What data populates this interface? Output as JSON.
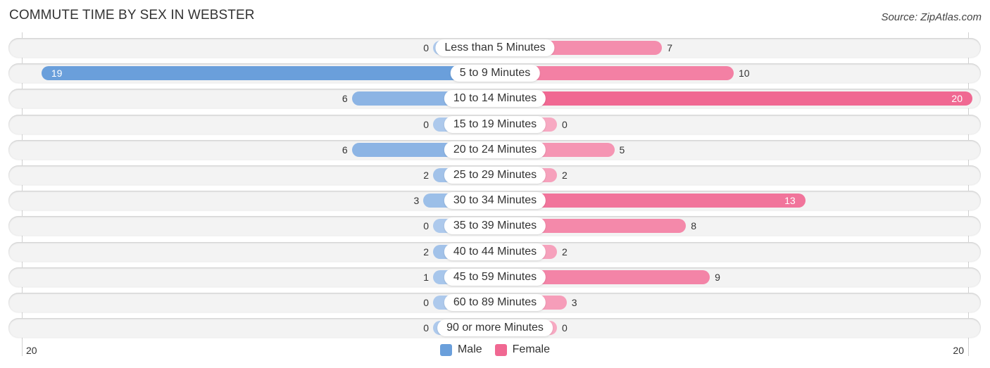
{
  "header": {
    "title": "COMMUTE TIME BY SEX IN WEBSTER",
    "source": "Source: ZipAtlas.com"
  },
  "chart_data": {
    "type": "bar",
    "orientation": "horizontal-diverging",
    "title": "COMMUTE TIME BY SEX IN WEBSTER",
    "categories": [
      "Less than 5 Minutes",
      "5 to 9 Minutes",
      "10 to 14 Minutes",
      "15 to 19 Minutes",
      "20 to 24 Minutes",
      "25 to 29 Minutes",
      "30 to 34 Minutes",
      "35 to 39 Minutes",
      "40 to 44 Minutes",
      "45 to 59 Minutes",
      "60 to 89 Minutes",
      "90 or more Minutes"
    ],
    "series": [
      {
        "name": "Male",
        "color": "#6a9fdb",
        "values": [
          0,
          19,
          6,
          0,
          6,
          2,
          3,
          0,
          2,
          1,
          0,
          0
        ]
      },
      {
        "name": "Female",
        "color": "#f06892",
        "values": [
          7,
          10,
          20,
          0,
          5,
          2,
          13,
          8,
          2,
          9,
          3,
          0
        ]
      }
    ],
    "xlim": [
      -20,
      20
    ],
    "axis_tick_labels": {
      "left": "20",
      "right": "20"
    },
    "legend": {
      "position": "bottom-center",
      "entries": [
        "Male",
        "Female"
      ]
    },
    "grid": false
  }
}
